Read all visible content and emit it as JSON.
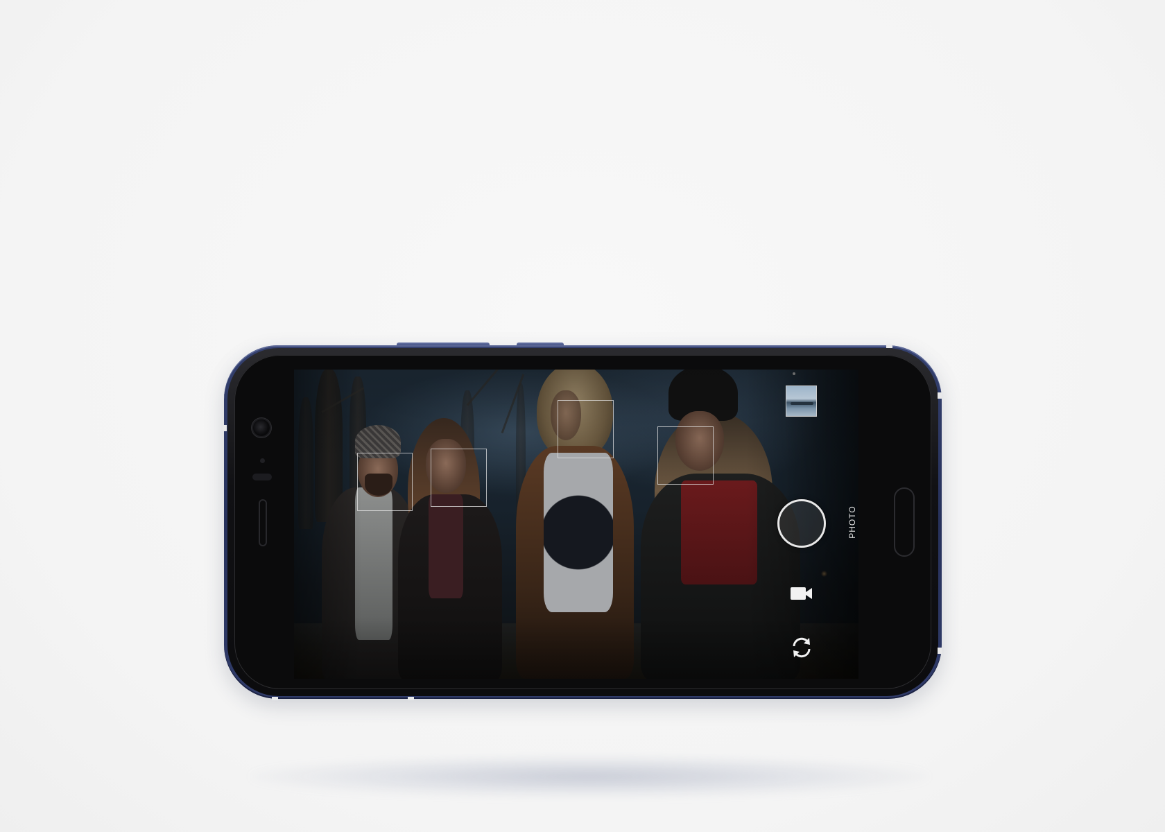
{
  "camera": {
    "mode_label": "PHOTO",
    "controls": {
      "gallery_icon": "gallery-thumbnail",
      "shutter_icon": "shutter-button",
      "video_icon": "video-camera-icon",
      "switch_icon": "switch-camera-icon"
    },
    "face_detection_boxes": 4
  },
  "colors": {
    "phone_frame": "#2c3766",
    "background": "#f6f6f6",
    "control_white": "#e8e8e8"
  }
}
